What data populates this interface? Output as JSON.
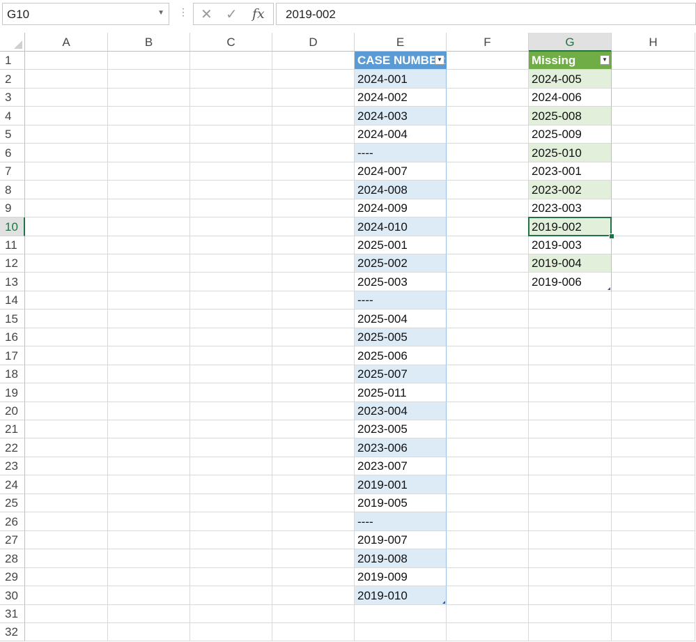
{
  "formula_bar": {
    "name_box": "G10",
    "dots": "⋮",
    "cancel_icon": "✕",
    "enter_icon": "✓",
    "fx_label": "fx",
    "value": "2019-002"
  },
  "columns": [
    "A",
    "B",
    "C",
    "D",
    "E",
    "F",
    "G",
    "H"
  ],
  "rows": [
    "1",
    "2",
    "3",
    "4",
    "5",
    "6",
    "7",
    "8",
    "9",
    "10",
    "11",
    "12",
    "13",
    "14",
    "15",
    "16",
    "17",
    "18",
    "19",
    "20",
    "21",
    "22",
    "23",
    "24",
    "25",
    "26",
    "27",
    "28",
    "29",
    "30",
    "31",
    "32"
  ],
  "selected_cell": {
    "column": "G",
    "row": "10"
  },
  "table_case": {
    "header": "CASE NUMBER",
    "header_color": "#5b9bd5",
    "band_color": "#ddebf7",
    "values": [
      "2024-001",
      "2024-002",
      "2024-003",
      "2024-004",
      "----",
      "2024-007",
      "2024-008",
      "2024-009",
      "2024-010",
      "2025-001",
      "2025-002",
      "2025-003",
      "----",
      "2025-004",
      "2025-005",
      "2025-006",
      "2025-007",
      "2025-011",
      "2023-004",
      "2023-005",
      "2023-006",
      "2023-007",
      "2019-001",
      "2019-005",
      "----",
      "2019-007",
      "2019-008",
      "2019-009",
      "2019-010"
    ]
  },
  "table_missing": {
    "header": "Missing",
    "header_color": "#70ad47",
    "band_color": "#e2efda",
    "values": [
      "2024-005",
      "2024-006",
      "2025-008",
      "2025-009",
      "2025-010",
      "2023-001",
      "2023-002",
      "2023-003",
      "2019-002",
      "2019-003",
      "2019-004",
      "2019-006"
    ]
  },
  "colors": {
    "selection": "#217346",
    "gridline": "#d9d9d9"
  }
}
